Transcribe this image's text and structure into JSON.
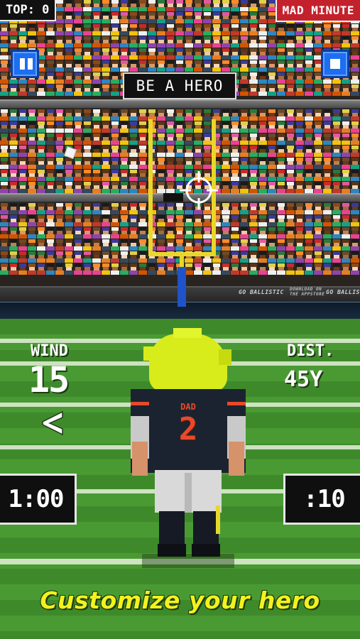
{
  "hud": {
    "top_score_label": "TOP: 0",
    "mode_label": "MAD MINUTE",
    "pause_icon": "pause-icon",
    "stop_icon": "stop-icon",
    "banner_text": "BE A HERO"
  },
  "wall_ads": {
    "brand_1": "GO BALLISTIC",
    "download_line_1": "DOWNLOAD ON",
    "download_line_2": "THE APPSTORE",
    "brand_2": "GO BALLIS"
  },
  "stats": {
    "wind_label": "WIND",
    "wind_value": "15",
    "wind_direction": "left",
    "dist_label": "DIST.",
    "dist_value": "45Y"
  },
  "timers": {
    "left": "1:00",
    "right": ":10"
  },
  "player": {
    "jersey_name": "DAD",
    "jersey_number": "2"
  },
  "caption": "Customize your hero",
  "colors": {
    "mode_badge": "#c3222d",
    "button_blue": "#1d6ef0",
    "goalpost": "#e8d72a",
    "goalpost_base": "#1f53c9",
    "caption": "#f2f21e",
    "jersey": "#1c2330",
    "jersey_accent": "#e84a2a",
    "hair": "#d8ec1c"
  }
}
